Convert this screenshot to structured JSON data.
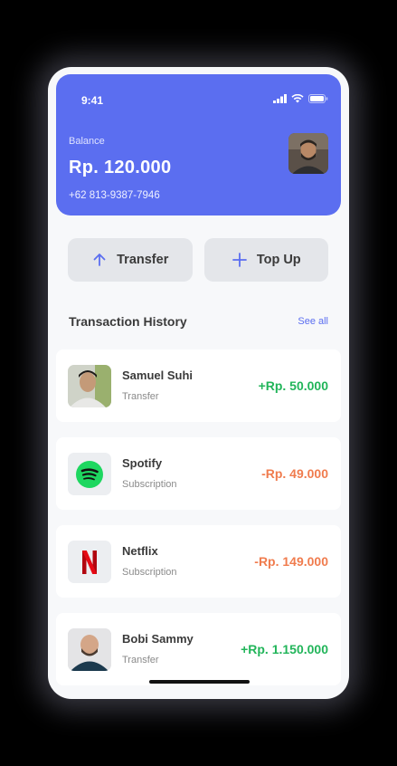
{
  "status_bar": {
    "time": "9:41"
  },
  "header": {
    "balance_label": "Balance",
    "balance_amount": "Rp. 120.000",
    "phone_number": "+62 813-9387-7946",
    "accent_color": "#5b6ef0"
  },
  "actions": {
    "transfer_label": "Transfer",
    "topup_label": "Top Up"
  },
  "transactions": {
    "title": "Transaction History",
    "see_all": "See all",
    "items": [
      {
        "name": "Samuel Suhi",
        "type": "Transfer",
        "amount": "+Rp. 50.000",
        "amount_color": "#22b55a",
        "icon": "avatar"
      },
      {
        "name": "Spotify",
        "type": "Subscription",
        "amount": "-Rp. 49.000",
        "amount_color": "#f07c4e",
        "icon": "spotify-logo"
      },
      {
        "name": "Netflix",
        "type": "Subscription",
        "amount": "-Rp. 149.000",
        "amount_color": "#f07c4e",
        "icon": "netflix-logo"
      },
      {
        "name": "Bobi Sammy",
        "type": "Transfer",
        "amount": "+Rp. 1.150.000",
        "amount_color": "#22b55a",
        "icon": "avatar"
      }
    ]
  }
}
